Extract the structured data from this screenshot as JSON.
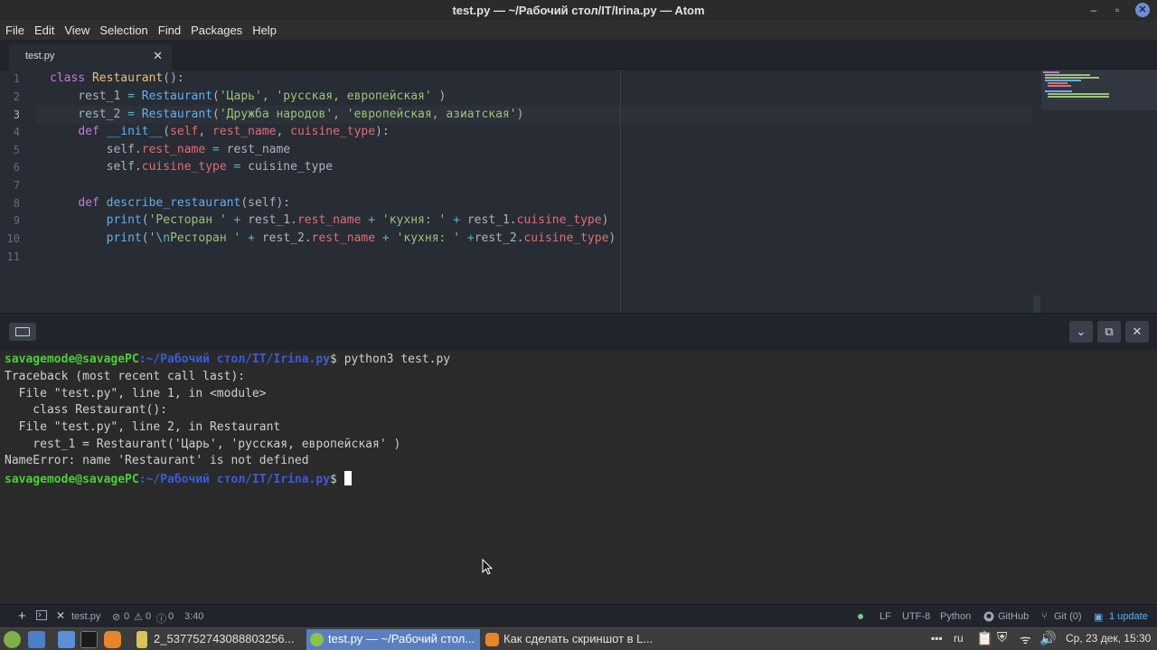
{
  "window": {
    "title": "test.py — ~/Рабочий стол/IT/Irina.py — Atom"
  },
  "menu": [
    "File",
    "Edit",
    "View",
    "Selection",
    "Find",
    "Packages",
    "Help"
  ],
  "tabs": [
    {
      "label": "test.py",
      "close": "✕"
    }
  ],
  "editor": {
    "line_numbers": [
      "1",
      "2",
      "3",
      "4",
      "5",
      "6",
      "7",
      "8",
      "9",
      "10",
      "11"
    ],
    "active_line": 3
  },
  "terminal": {
    "prompt_user": "savagemode@savagePC",
    "prompt_path": ":~/Рабочий стол/IT/Irina.py",
    "prompt_symbol": "$",
    "command": " python3 test.py",
    "output": [
      "Traceback (most recent call last):",
      "  File \"test.py\", line 1, in <module>",
      "    class Restaurant():",
      "  File \"test.py\", line 2, in Restaurant",
      "    rest_1 = Restaurant('Царь', 'русская, европейская' )",
      "NameError: name 'Restaurant' is not defined"
    ],
    "controls": {
      "collapse": "⌄",
      "maximize": "⧉",
      "close": "✕"
    }
  },
  "statusbar": {
    "add": "+",
    "file": "test.py",
    "errors": "0",
    "warnings": "0",
    "infos": "0",
    "cursor_pos": "3:40",
    "line_ending": "LF",
    "encoding": "UTF-8",
    "grammar": "Python",
    "github": "GitHub",
    "git": "Git (0)",
    "updates": "1 update"
  },
  "taskbar": {
    "tasks": [
      {
        "label": "2_537752743088803256..."
      },
      {
        "label": "test.py — ~/Рабочий стол..."
      },
      {
        "label": "Как сделать скриншот в L..."
      }
    ],
    "keyboard_layout": "ru",
    "clock": "Ср, 23 дек, 15:30"
  },
  "colors": {
    "editor_bg": "#282c34",
    "terminal_bg": "#2a2a2a",
    "prompt_user": "#4ccd3a",
    "prompt_path": "#3b5bdb",
    "accent": "#5a7fc0"
  }
}
